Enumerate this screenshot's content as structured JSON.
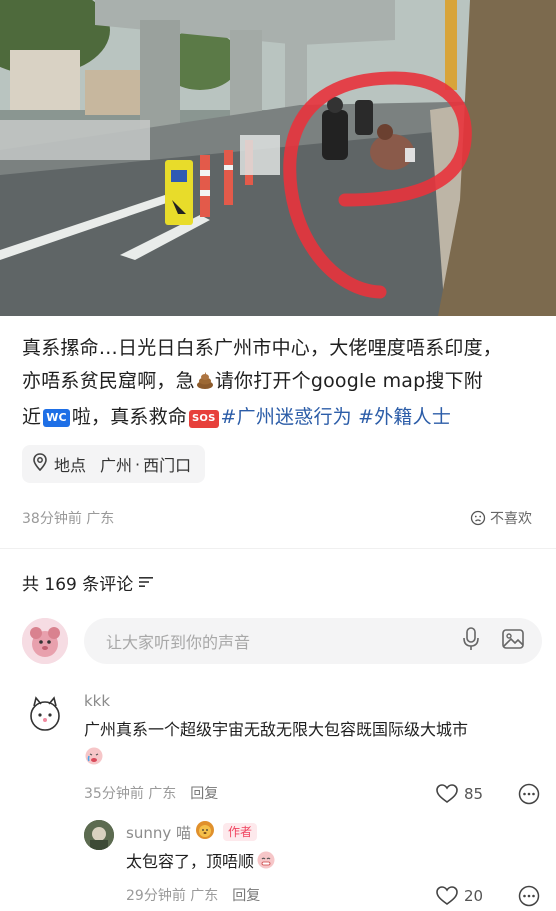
{
  "post": {
    "text_line1": "真系摞命…日光日白系广州市中心，大佬哩度唔系印度，",
    "text_line2a": "亦唔系贫民窟啊，急",
    "text_line2b": "请你打开个google map搜下附",
    "text_line3a": "近",
    "wc_badge": "WC",
    "text_line3b": "啦，真系救命",
    "sos_badge": "SOS",
    "hashtag1": "#广州迷惑行为",
    "hashtag2": "#外籍人士"
  },
  "location": {
    "label": "地点",
    "city": "广州",
    "place": "西门口"
  },
  "meta": {
    "time_region": "38分钟前 广东",
    "dislike_label": "不喜欢"
  },
  "comments_header": {
    "count_text": "共 169 条评论"
  },
  "input": {
    "placeholder": "让大家听到你的声音"
  },
  "comments": [
    {
      "user": "kkk",
      "text": "广州真系一个超级宇宙无敌无限大包容既国际级大城市",
      "time_region": "35分钟前 广东",
      "reply_label": "回复",
      "likes": "85"
    }
  ],
  "reply": {
    "user": "sunny 喵",
    "author_tag": "作者",
    "text": "太包容了，顶唔顺",
    "time_region": "29分钟前 广东",
    "reply_label": "回复",
    "likes": "20"
  },
  "icons": {
    "location": "location-pin-icon",
    "dislike": "frown-face-icon",
    "sort": "sort-lines-icon",
    "mic": "microphone-icon",
    "image": "image-icon",
    "heart": "heart-icon",
    "more": "more-dots-icon"
  },
  "colors": {
    "hashtag": "#2c5da8",
    "author_tag": "#f0445f",
    "red_annotation": "#e8333c"
  }
}
